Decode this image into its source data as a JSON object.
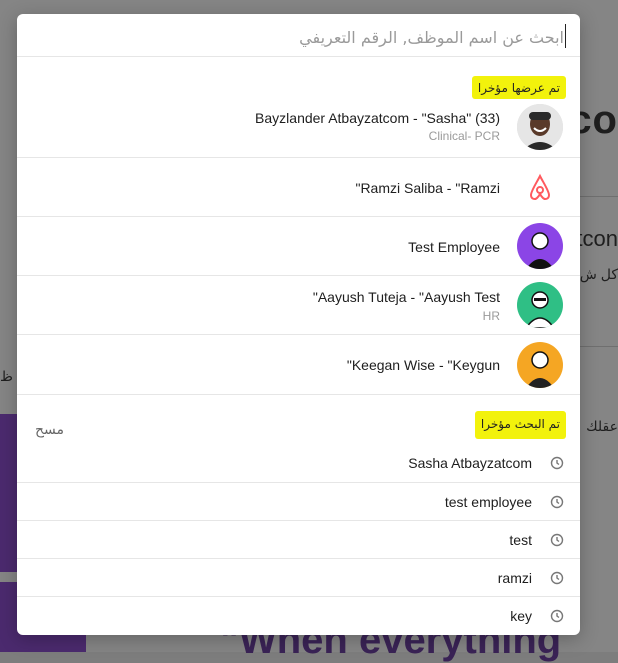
{
  "search": {
    "placeholder": "ابحث عن اسم الموظف, الرقم التعريفي",
    "value": ""
  },
  "recent_viewed": {
    "heading": "تم عرضها مؤخرا",
    "items": [
      {
        "name": "Bayzlander Atbayzatcom - \"Sasha\" (33)",
        "subtitle": "Clinical- PCR",
        "avatar": "photo-avatar"
      },
      {
        "name": "\"Ramzi Saliba - \"Ramzi",
        "subtitle": "",
        "avatar": "airbnb-logo-icon"
      },
      {
        "name": "Test Employee",
        "subtitle": "",
        "avatar": "illustrated-avatar-purple"
      },
      {
        "name": "\"Aayush Tuteja - \"Aayush Test",
        "subtitle": "HR",
        "avatar": "illustrated-avatar-green"
      },
      {
        "name": "\"Keegan Wise - \"Keygun",
        "subtitle": "",
        "avatar": "illustrated-avatar-orange"
      }
    ]
  },
  "recent_searches": {
    "heading": "تم البحث مؤخرا",
    "clear_label": "مسح",
    "items": [
      "Sasha Atbayzatcom",
      "test employee",
      "test",
      "ramzi",
      "key"
    ]
  },
  "colors": {
    "highlight": "#f2f20c",
    "avatar_purple": "#8b45e6",
    "avatar_green": "#2fbf85",
    "avatar_orange": "#f5a623",
    "airbnb": "#ff5a5f"
  },
  "background": {
    "fragment_large": "co",
    "fragment_mid": "tcon",
    "fragment_small": "كل ش",
    "fragment_left1": "ظ",
    "fragment_left2": "عقلك",
    "fragment_bottom": "\"When everything"
  }
}
